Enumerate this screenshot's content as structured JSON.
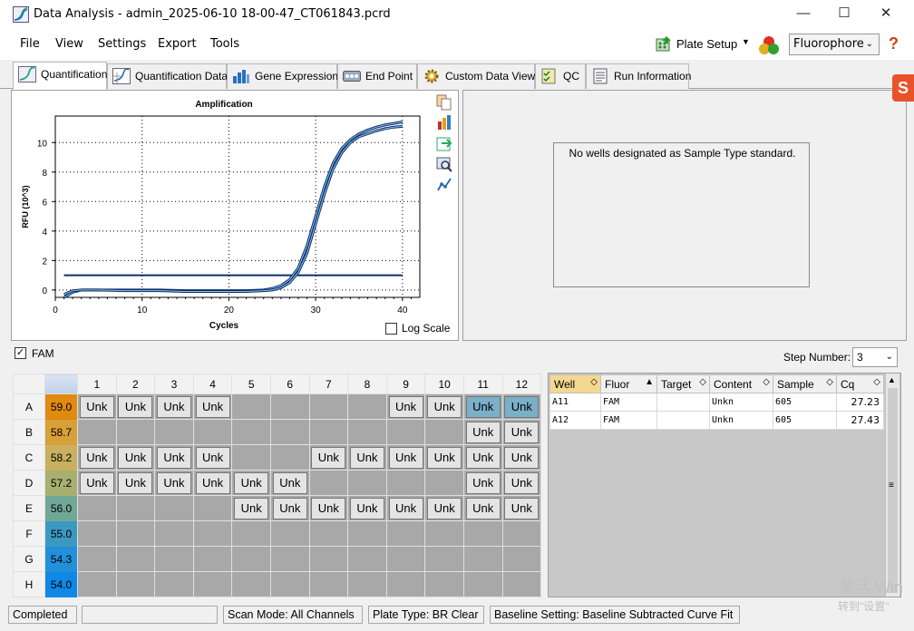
{
  "window": {
    "title": "Data Analysis - admin_2025-06-10 18-00-47_CT061843.pcrd",
    "min": "—",
    "max": "☐",
    "close": "✕"
  },
  "menu": [
    "File",
    "View",
    "Settings",
    "Export",
    "Tools"
  ],
  "toolbar": {
    "plate_setup": "Plate Setup",
    "fluorophore": "Fluorophore",
    "help": "?"
  },
  "tabs": [
    "Quantification",
    "Quantification Data",
    "Gene Expression",
    "End Point",
    "Custom Data View",
    "QC",
    "Run Information"
  ],
  "chart_data": {
    "type": "line",
    "title": "Amplification",
    "xlabel": "Cycles",
    "ylabel": "RFU (10^3)",
    "xlim": [
      0,
      42
    ],
    "ylim": [
      -0.5,
      11.8
    ],
    "xticks": [
      0,
      10,
      20,
      30,
      40
    ],
    "yticks": [
      0,
      2,
      4,
      6,
      8,
      10
    ],
    "grid": true,
    "threshold": 1.0,
    "series": [
      {
        "x": [
          1,
          2,
          3,
          5,
          8,
          10,
          12,
          15,
          18,
          20,
          22,
          24,
          25,
          26,
          27,
          28,
          29,
          30,
          31,
          32,
          33,
          34,
          35,
          36,
          37,
          38,
          39,
          40
        ],
        "y": [
          -0.5,
          -0.15,
          0.0,
          0.0,
          0.0,
          0.0,
          0.0,
          -0.05,
          -0.05,
          -0.05,
          -0.05,
          0.0,
          0.1,
          0.3,
          0.7,
          1.5,
          3.0,
          5.0,
          7.0,
          8.6,
          9.6,
          10.2,
          10.6,
          10.85,
          11.05,
          11.2,
          11.3,
          11.4
        ]
      },
      {
        "x": [
          1,
          2,
          3,
          5,
          8,
          10,
          12,
          15,
          18,
          20,
          22,
          24,
          25,
          26,
          27,
          28,
          29,
          30,
          31,
          32,
          33,
          34,
          35,
          36,
          37,
          38,
          39,
          40
        ],
        "y": [
          -0.3,
          -0.05,
          0.0,
          0.0,
          -0.05,
          -0.05,
          -0.05,
          -0.1,
          -0.1,
          -0.1,
          -0.1,
          -0.05,
          0.0,
          0.15,
          0.5,
          1.2,
          2.5,
          4.5,
          6.5,
          8.2,
          9.3,
          10.0,
          10.4,
          10.6,
          10.8,
          10.95,
          11.05,
          11.1
        ]
      }
    ]
  },
  "log_scale": "Log Scale",
  "no_standard": "No wells designated as Sample Type standard.",
  "fam_label": "FAM",
  "step": {
    "label": "Step Number:",
    "value": "3"
  },
  "plate": {
    "cols": [
      "1",
      "2",
      "3",
      "4",
      "5",
      "6",
      "7",
      "8",
      "9",
      "10",
      "11",
      "12"
    ],
    "rows": [
      {
        "label": "A",
        "temp": "59.0",
        "color": "#e08a10",
        "wells": [
          "Unk",
          "Unk",
          "Unk",
          "Unk",
          "",
          "",
          "",
          "",
          "Unk",
          "Unk",
          "Unk*",
          "Unk*"
        ]
      },
      {
        "label": "B",
        "temp": "58.7",
        "color": "#d8a038",
        "wells": [
          "",
          "",
          "",
          "",
          "",
          "",
          "",
          "",
          "",
          "",
          "Unk",
          "Unk"
        ]
      },
      {
        "label": "C",
        "temp": "58.2",
        "color": "#c8b060",
        "wells": [
          "Unk",
          "Unk",
          "Unk",
          "Unk",
          "",
          "",
          "Unk",
          "Unk",
          "Unk",
          "Unk",
          "Unk",
          "Unk"
        ]
      },
      {
        "label": "D",
        "temp": "57.2",
        "color": "#a8b070",
        "wells": [
          "Unk",
          "Unk",
          "Unk",
          "Unk",
          "Unk",
          "Unk",
          "",
          "",
          "",
          "",
          "Unk",
          "Unk"
        ]
      },
      {
        "label": "E",
        "temp": "56.0",
        "color": "#70a898",
        "wells": [
          "",
          "",
          "",
          "",
          "Unk",
          "Unk",
          "Unk",
          "Unk",
          "Unk",
          "Unk",
          "Unk",
          "Unk"
        ]
      },
      {
        "label": "F",
        "temp": "55.0",
        "color": "#3c98c0",
        "wells": [
          "",
          "",
          "",
          "",
          "",
          "",
          "",
          "",
          "",
          "",
          "",
          ""
        ]
      },
      {
        "label": "G",
        "temp": "54.3",
        "color": "#2090d8",
        "wells": [
          "",
          "",
          "",
          "",
          "",
          "",
          "",
          "",
          "",
          "",
          "",
          ""
        ]
      },
      {
        "label": "H",
        "temp": "54.0",
        "color": "#1088e8",
        "wells": [
          "",
          "",
          "",
          "",
          "",
          "",
          "",
          "",
          "",
          "",
          "",
          ""
        ]
      }
    ]
  },
  "results": {
    "headers": [
      "Well",
      "Fluor",
      "Target",
      "Content",
      "Sample",
      "Cq"
    ],
    "rows": [
      [
        "A11",
        "FAM",
        "",
        "Unkn",
        "605",
        "27.23"
      ],
      [
        "A12",
        "FAM",
        "",
        "Unkn",
        "605",
        "27.43"
      ]
    ]
  },
  "status": {
    "state": "Completed",
    "scan": "Scan Mode: All Channels",
    "plate_type": "Plate Type: BR Clear",
    "baseline": "Baseline Setting: Baseline Subtracted Curve Fit"
  },
  "watermark": {
    "line1": "激活 Win",
    "line2": "转到\"设置\""
  }
}
